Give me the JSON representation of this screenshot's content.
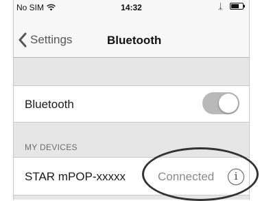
{
  "status_bar": {
    "carrier": "No SIM",
    "time": "14:32",
    "icons": [
      "wifi-icon",
      "bluetooth-icon",
      "battery-icon"
    ]
  },
  "nav": {
    "back_label": "Settings",
    "back_icon": "chevron-left-icon",
    "title": "Bluetooth"
  },
  "bluetooth_row": {
    "label": "Bluetooth",
    "toggle_state": "on"
  },
  "devices_section": {
    "header": "MY DEVICES",
    "devices": [
      {
        "name": "STAR mPOP-xxxxx",
        "status": "Connected",
        "info_glyph": "i"
      }
    ]
  },
  "colors": {
    "toggle_track": "#b9b9b9",
    "group_background": "#e6e6e6",
    "highlight_ellipse": "#333333"
  }
}
